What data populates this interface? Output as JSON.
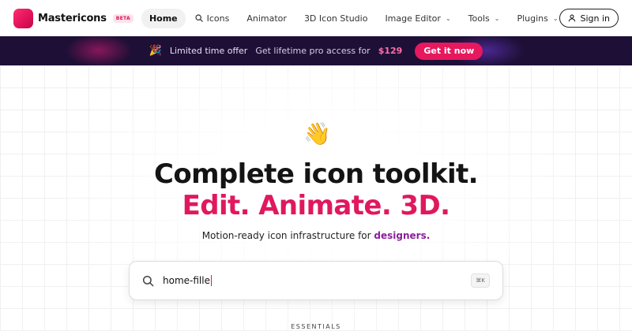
{
  "brand": {
    "name": "Mastericons",
    "badge": "BETA",
    "color": "#e0185e"
  },
  "nav": {
    "items": [
      {
        "label": "Home",
        "active": true
      },
      {
        "label": "Icons",
        "icon": "search-icon"
      },
      {
        "label": "Animator"
      },
      {
        "label": "3D Icon Studio"
      },
      {
        "label": "Image Editor",
        "dropdown": true
      },
      {
        "label": "Tools",
        "dropdown": true
      },
      {
        "label": "Plugins",
        "dropdown": true
      }
    ],
    "sign_in": "Sign in"
  },
  "banner": {
    "emoji": "🎉",
    "label": "Limited time offer",
    "text": "Get lifetime pro access for",
    "price": "$129",
    "cta": "Get it now",
    "background": "#1e0f36"
  },
  "hero": {
    "emoji": "👋",
    "headline": "Complete icon toolkit.",
    "headline_accent": "Edit. Animate. 3D.",
    "sub_prefix": "Motion-ready icon infrastructure for",
    "sub_highlight": "designers."
  },
  "search": {
    "value": "home-fille",
    "shortcut": "⌘K"
  },
  "section": {
    "label": "ESSENTIALS"
  }
}
